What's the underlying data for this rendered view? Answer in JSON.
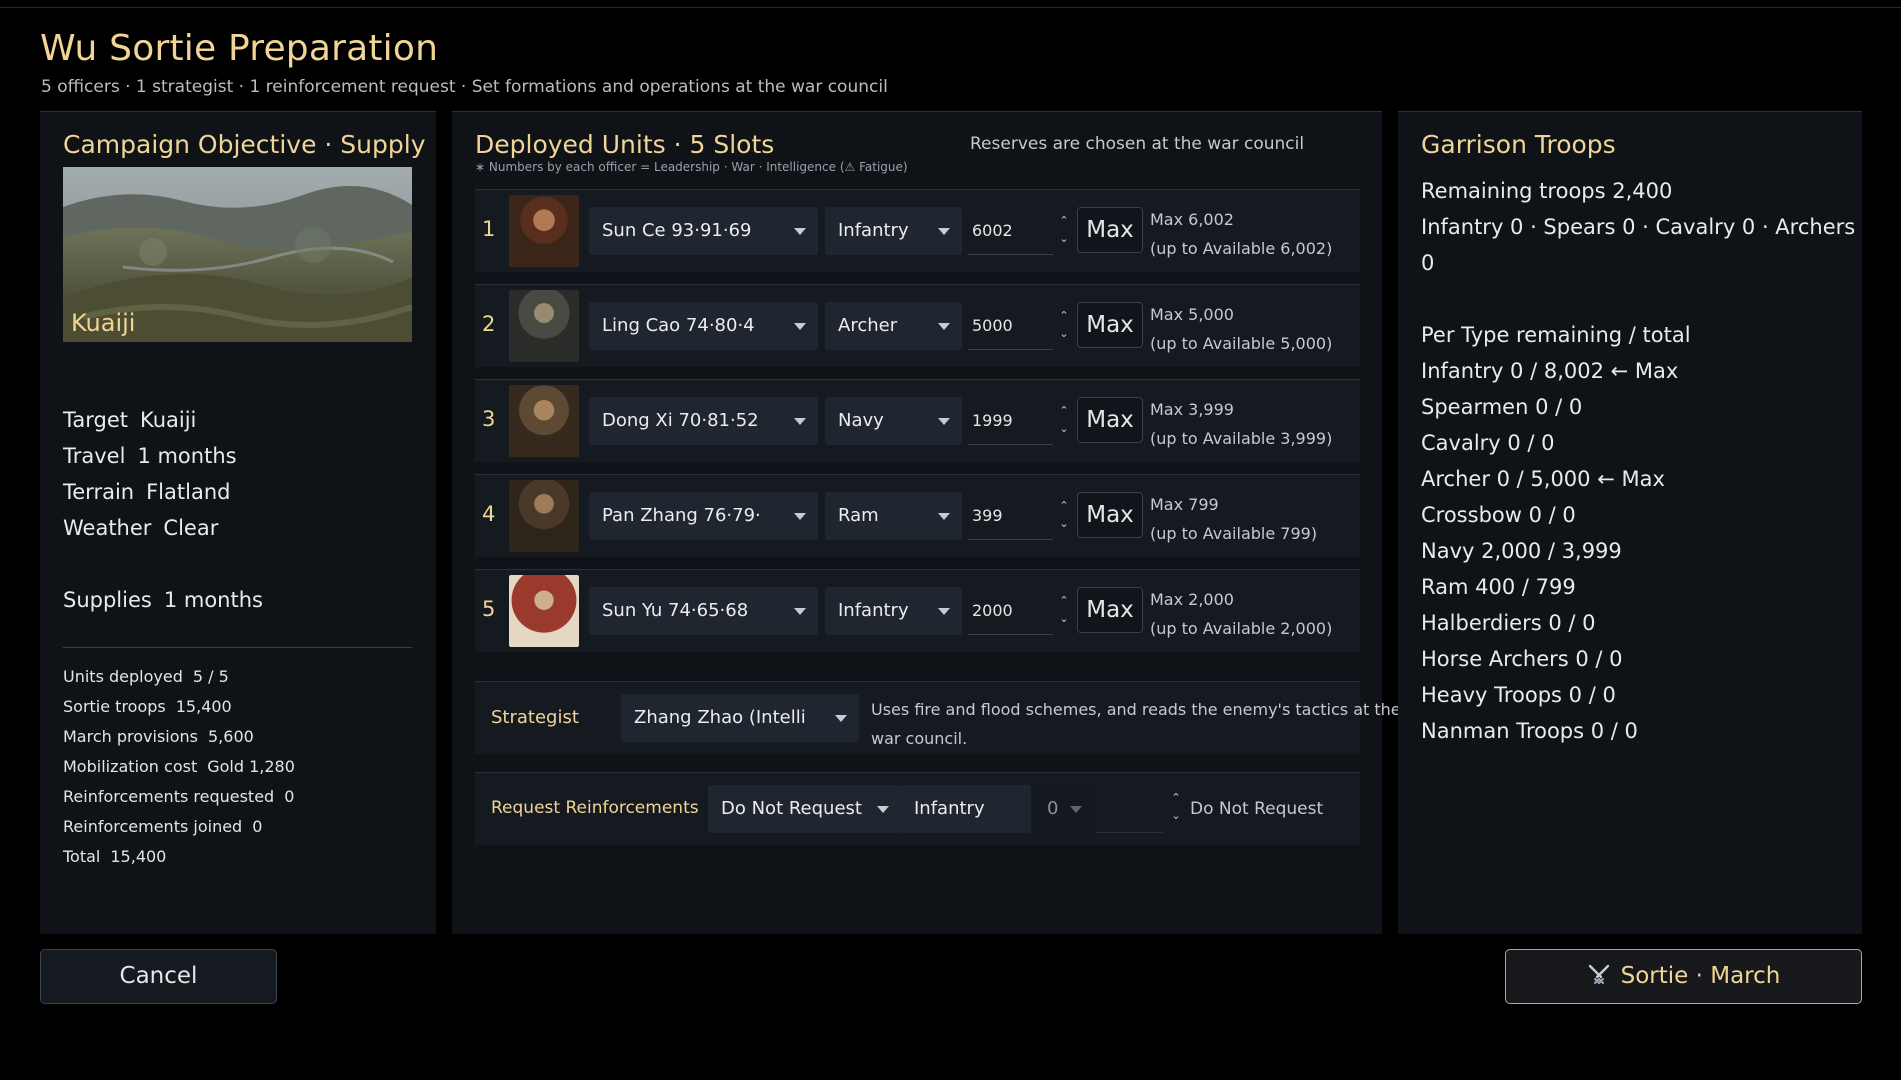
{
  "header": {
    "title": "Wu Sortie Preparation",
    "subtitle": "5 officers · 1 strategist · 1 reinforcement request   ·   Set formations and operations at the war council"
  },
  "objective": {
    "title": "Campaign Objective · Supply",
    "map_label": "Kuaiji",
    "details": [
      {
        "k": "Target",
        "v": "Kuaiji"
      },
      {
        "k": "Travel",
        "v": "1 months"
      },
      {
        "k": "Terrain",
        "v": "Flatland"
      },
      {
        "k": "Weather",
        "v": "Clear"
      }
    ],
    "supplies": {
      "k": "Supplies",
      "v": "1 months"
    },
    "stats": [
      {
        "k": "Units deployed",
        "v": "5 / 5"
      },
      {
        "k": "Sortie troops",
        "v": "15,400"
      },
      {
        "k": "March provisions",
        "v": "5,600"
      },
      {
        "k": "Mobilization cost",
        "v": "Gold 1,280"
      },
      {
        "k": "Reinforcements requested",
        "v": "0"
      },
      {
        "k": "Reinforcements joined",
        "v": "0"
      },
      {
        "k": "Total",
        "v": "15,400"
      }
    ]
  },
  "deployed": {
    "title": "Deployed Units   ·   5 Slots",
    "note": "∗ Numbers by each officer = Leadership · War · Intelligence   (⚠ Fatigue)",
    "reserve_note": "Reserves are chosen at the war council",
    "max_label": "Max",
    "units": [
      {
        "num": "1",
        "officer": "Sun Ce  93·91·69",
        "type": "Infantry",
        "qty": "6002",
        "max_line": "Max 6,002",
        "avail_line": "(up to Available 6,002)"
      },
      {
        "num": "2",
        "officer": "Ling Cao  74·80·4",
        "type": "Archer",
        "qty": "5000",
        "max_line": "Max 5,000",
        "avail_line": "(up to Available 5,000)"
      },
      {
        "num": "3",
        "officer": "Dong Xi  70·81·52",
        "type": "Navy",
        "qty": "1999",
        "max_line": "Max 3,999",
        "avail_line": "(up to Available 3,999)"
      },
      {
        "num": "4",
        "officer": "Pan Zhang  76·79·",
        "type": "Ram",
        "qty": "399",
        "max_line": "Max 799",
        "avail_line": "(up to Available 799)"
      },
      {
        "num": "5",
        "officer": "Sun Yu  74·65·68",
        "type": "Infantry",
        "qty": "2000",
        "max_line": "Max 2,000",
        "avail_line": "(up to Available 2,000)"
      }
    ],
    "strategist": {
      "label": "Strategist",
      "value": "Zhang Zhao  (Intelli",
      "desc": "Uses fire and flood schemes, and reads the enemy's tactics at the war council."
    },
    "reinforcements": {
      "label": "Request Reinforcements",
      "mode": "Do Not Request",
      "type": "Infantry",
      "amount": "0",
      "status": "Do Not Request"
    }
  },
  "garrison": {
    "title": "Garrison Troops",
    "remaining": "Remaining troops    2,400",
    "breakdown_1": "Infantry 0 · Spears 0 · Cavalry 0 · Archers",
    "breakdown_2": "0",
    "per_type_header": "Per Type   remaining / total",
    "types": [
      {
        "text": "Infantry    0 / 8,002    ← Max"
      },
      {
        "text": "Spearmen    0 / 0"
      },
      {
        "text": "Cavalry    0 / 0"
      },
      {
        "text": "Archer    0 / 5,000    ← Max"
      },
      {
        "text": "Crossbow    0 / 0"
      },
      {
        "text": "Navy    2,000 / 3,999"
      },
      {
        "text": "Ram    400 / 799"
      },
      {
        "text": "Halberdiers    0 / 0"
      },
      {
        "text": "Horse Archers    0 / 0"
      },
      {
        "text": "Heavy Troops    0 / 0"
      },
      {
        "text": "Nanman Troops    0 / 0"
      }
    ]
  },
  "buttons": {
    "cancel": "Cancel",
    "sortie_icon": "crossed-swords-icon",
    "sortie": "Sortie · March"
  },
  "colors": {
    "accent_gold": "#f0d595",
    "panel": "#0f1318",
    "row": "#151a21",
    "select": "#1f2630",
    "sortie_border": "#c9a560"
  }
}
